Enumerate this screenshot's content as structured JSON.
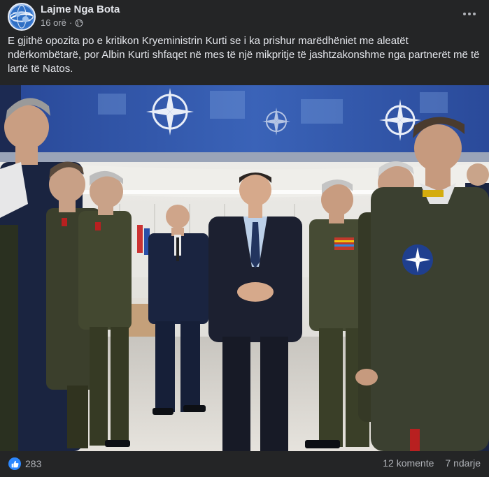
{
  "post": {
    "page_name": "Lajme Nga Bota",
    "time": "16 orë",
    "separator": "·",
    "privacy_icon": "globe-icon",
    "avatar_icon": "globe-logo",
    "more_icon": "more-options-icon",
    "caption": "E gjithë opozita po e kritikon Kryeministrin Kurti se i ka prishur marëdhëniet me aleatët ndërkombëtarë, por Albin Kurti shfaqet në mes të një mikpritje të jashtzakonshme nga partnerët më të lartë të Natos."
  },
  "photo": {
    "description_icon": "nato-star-emblem",
    "colors": {
      "nato_blue": "#1f3f8f",
      "uniform_green": "#3b3f2c",
      "uniform_navy": "#1a2440",
      "suit": "#1c2030"
    }
  },
  "footer": {
    "reaction_icon": "like-icon",
    "reaction_count": "283",
    "comments": "12 komente",
    "shares": "7 ndarje"
  },
  "colors": {
    "background": "#242526",
    "text": "#e4e6eb",
    "muted": "#b0b3b8",
    "accent": "#2d88ff"
  }
}
